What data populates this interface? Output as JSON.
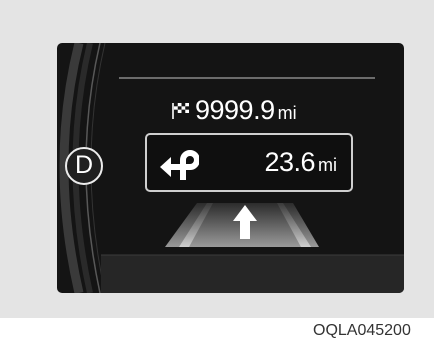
{
  "display": {
    "gear": "D",
    "destination": {
      "icon": "checkered-flag-icon",
      "distance": "9999.9",
      "unit": "mi"
    },
    "next_turn": {
      "icon": "turn-left-u-turn-icon",
      "distance": "23.6",
      "unit": "mi"
    },
    "lane_guidance": {
      "icon": "straight-arrow-icon"
    }
  },
  "caption": "OQLA045200",
  "colors": {
    "background": "#e4e4e4",
    "screen": "#141414",
    "text": "#ffffff",
    "road": "#8a8a8a"
  }
}
